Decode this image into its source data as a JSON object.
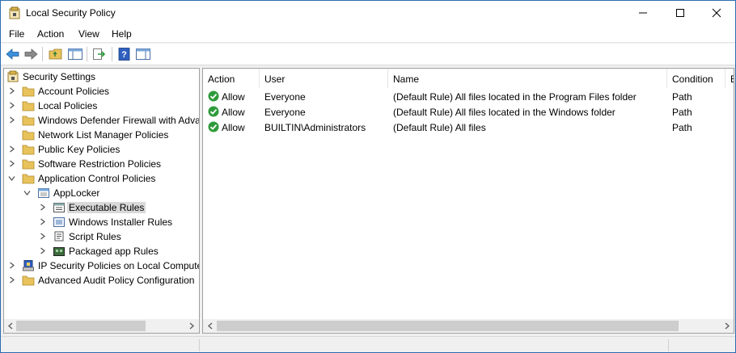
{
  "window": {
    "title": "Local Security Policy"
  },
  "menu": [
    "File",
    "Action",
    "View",
    "Help"
  ],
  "toolbar": {
    "buttons": [
      "back-icon",
      "forward-icon",
      "up-folder-icon",
      "show-hide-tree-icon",
      "export-list-icon",
      "help-icon",
      "action-pane-icon"
    ]
  },
  "tree": {
    "root": "Security Settings",
    "items": [
      {
        "label": "Account Policies"
      },
      {
        "label": "Local Policies"
      },
      {
        "label": "Windows Defender Firewall with Adva"
      },
      {
        "label": "Network List Manager Policies"
      },
      {
        "label": "Public Key Policies"
      },
      {
        "label": "Software Restriction Policies"
      },
      {
        "label": "Application Control Policies"
      },
      {
        "label": "AppLocker"
      },
      {
        "label": "Executable Rules"
      },
      {
        "label": "Windows Installer Rules"
      },
      {
        "label": "Script Rules"
      },
      {
        "label": "Packaged app Rules"
      },
      {
        "label": "IP Security Policies on Local Compute"
      },
      {
        "label": "Advanced Audit Policy Configuration"
      }
    ],
    "selected": "Executable Rules"
  },
  "list": {
    "columns": [
      "Action",
      "User",
      "Name",
      "Condition",
      "E:"
    ],
    "rows": [
      {
        "action": "Allow",
        "user": "Everyone",
        "name": "(Default Rule) All files located in the Program Files folder",
        "condition": "Path"
      },
      {
        "action": "Allow",
        "user": "Everyone",
        "name": "(Default Rule) All files located in the Windows folder",
        "condition": "Path"
      },
      {
        "action": "Allow",
        "user": "BUILTIN\\Administrators",
        "name": "(Default Rule) All files",
        "condition": "Path"
      }
    ]
  },
  "colors": {
    "allow_green": "#2e9b3a",
    "folder_yellow": "#e8c25a",
    "selection": "#d9d9d9",
    "window_border": "#2b6cb0"
  }
}
